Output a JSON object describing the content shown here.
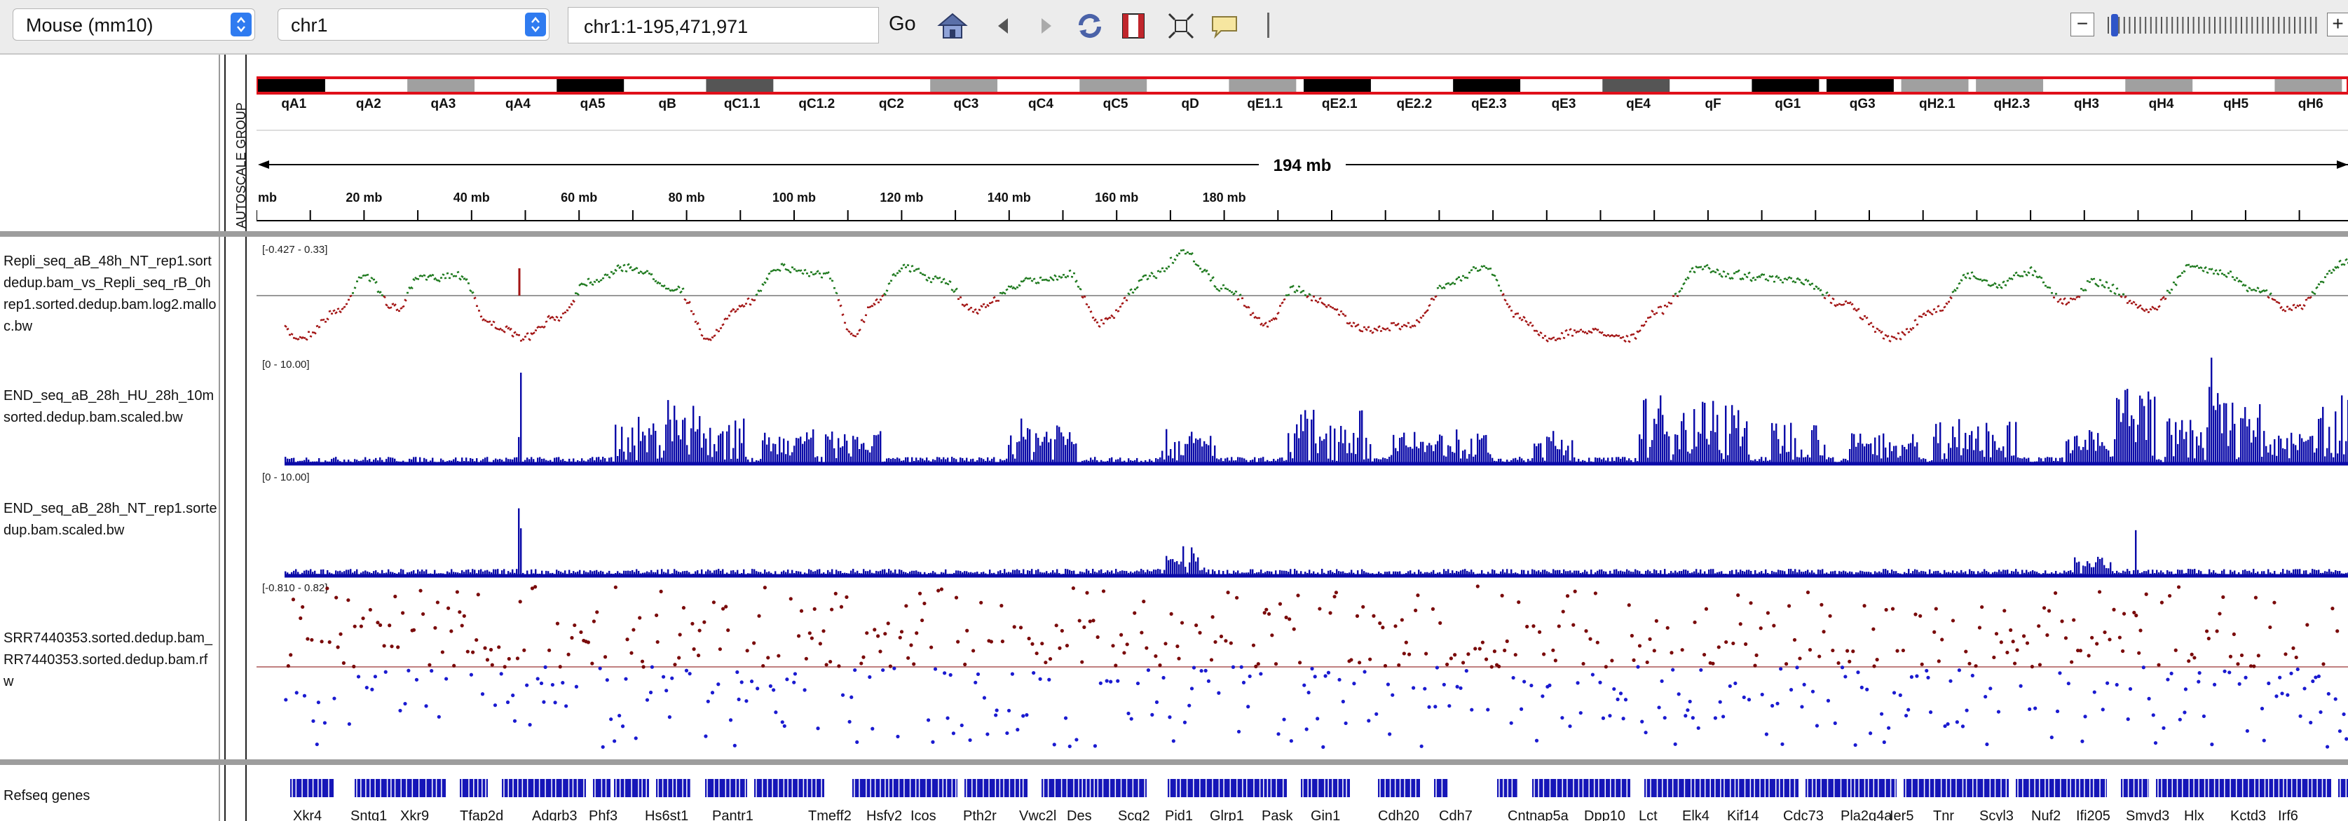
{
  "toolbar": {
    "genome": "Mouse (mm10)",
    "chromosome": "chr1",
    "locus": "chr1:1-195,471,971",
    "go_label": "Go",
    "icons": [
      "home-icon",
      "back-icon",
      "forward-icon",
      "refresh-icon",
      "ruler-icon",
      "resize-icon",
      "popup-info-icon"
    ],
    "zoom_minus": "−",
    "zoom_plus": "+"
  },
  "ideogram": {
    "bands": [
      "qA1",
      "qA2",
      "qA3",
      "qA4",
      "qA5",
      "qB",
      "qC1.1",
      "qC1.2",
      "qC2",
      "qC3",
      "qC4",
      "qC5",
      "qD",
      "qE1.1",
      "qE2.1",
      "qE2.2",
      "qE2.3",
      "qE3",
      "qE4",
      "qF",
      "qG1",
      "qG3",
      "qH2.1",
      "qH2.3",
      "qH3",
      "qH4",
      "qH5",
      "qH6"
    ]
  },
  "ruler": {
    "span_label": "194 mb",
    "ticks": [
      "mb",
      "20 mb",
      "40 mb",
      "60 mb",
      "80 mb",
      "100 mb",
      "120 mb",
      "140 mb",
      "160 mb",
      "180 mb"
    ]
  },
  "attribute": {
    "autoscale_label": "AUTOSCALE GROUP"
  },
  "tracks": [
    {
      "name_lines": [
        "Repli_seq_aB_48h_NT_rep1.sort",
        "dedup.bam_vs_Repli_seq_rB_0h",
        "rep1.sorted.dedup.bam.log2.mallo",
        "c.bw"
      ],
      "range": "[-0.427 - 0.33]",
      "pos_color": "#1f7a1f",
      "neg_color": "#a31515"
    },
    {
      "name_lines": [
        "END_seq_aB_28h_HU_28h_10m",
        "sorted.dedup.bam.scaled.bw"
      ],
      "range": "[0 - 10.00]",
      "color": "#0a0aa8"
    },
    {
      "name_lines": [
        "END_seq_aB_28h_NT_rep1.sorte",
        "dup.bam.scaled.bw"
      ],
      "range": "[0 - 10.00]",
      "color": "#0a0aa8"
    },
    {
      "name_lines": [
        "SRR7440353.sorted.dedup.bam_",
        "RR7440353.sorted.dedup.bam.rf",
        "w"
      ],
      "range": "[-0.810 - 0.82]",
      "pos_color": "#7a0a0a",
      "neg_color": "#1a1ad0"
    }
  ],
  "genes_track": {
    "name": "Refseq genes",
    "color": "#1616b8",
    "labels": [
      "Xkr4",
      "Sntg1",
      "Xkr9",
      "Tfap2d",
      "Adgrb3",
      "Phf3",
      "Hs6st1",
      "Pantr1",
      "Tmeff2",
      "Hsfy2",
      "Icos",
      "Pth2r",
      "Vwc2l",
      "Des",
      "Scg2",
      "Pid1",
      "Glrp1",
      "Pask",
      "Gin1",
      "Cdh20",
      "Cdh7",
      "Cntnap5a",
      "Dpp10",
      "Lct",
      "Elk4",
      "Kif14",
      "Cdc73",
      "Pla2g4a",
      "Ier5",
      "Tnr",
      "Scyl3",
      "Nuf2",
      "Ifi205",
      "Smyd3",
      "Hlx",
      "Kctd3",
      "Irf6"
    ]
  }
}
